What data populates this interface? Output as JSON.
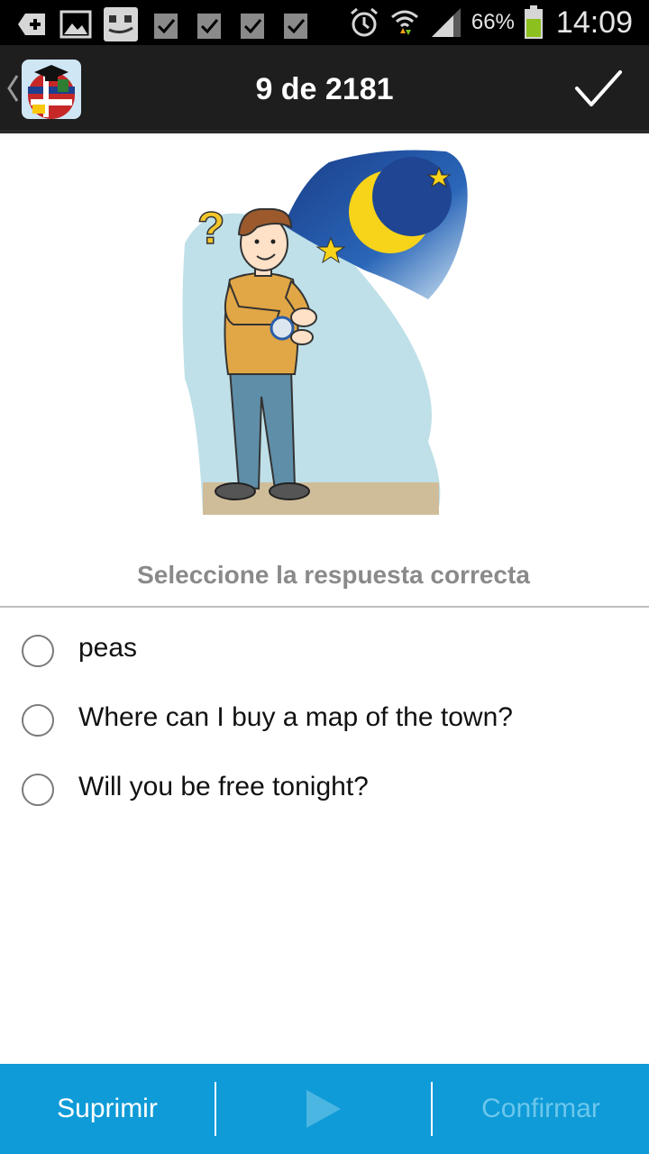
{
  "status_bar": {
    "icons": [
      "add-icon",
      "image-icon",
      "chat-icon",
      "task-icon",
      "task-icon",
      "task-icon",
      "task-icon",
      "alarm-icon",
      "wifi-icon",
      "signal-icon",
      "battery-icon"
    ],
    "battery": "66%",
    "time": "14:09",
    "battery_color": "#8cc01e"
  },
  "action_bar": {
    "counter": "9 de 2181",
    "app_icon": "globe-graduation-icon",
    "confirm_icon": "checkmark-icon"
  },
  "question": {
    "prompt": "Seleccione la respuesta correcta",
    "image": "man-checking-watch-at-night-illustration",
    "options": [
      {
        "label": "peas",
        "selected": false
      },
      {
        "label": "Where can I buy a map of the town?",
        "selected": false
      },
      {
        "label": "Will you be free tonight?",
        "selected": false
      }
    ]
  },
  "bottom_bar": {
    "delete_label": "Suprimir",
    "play_icon": "play-icon",
    "confirm_label": "Confirmar",
    "background": "#0f9bd7"
  }
}
